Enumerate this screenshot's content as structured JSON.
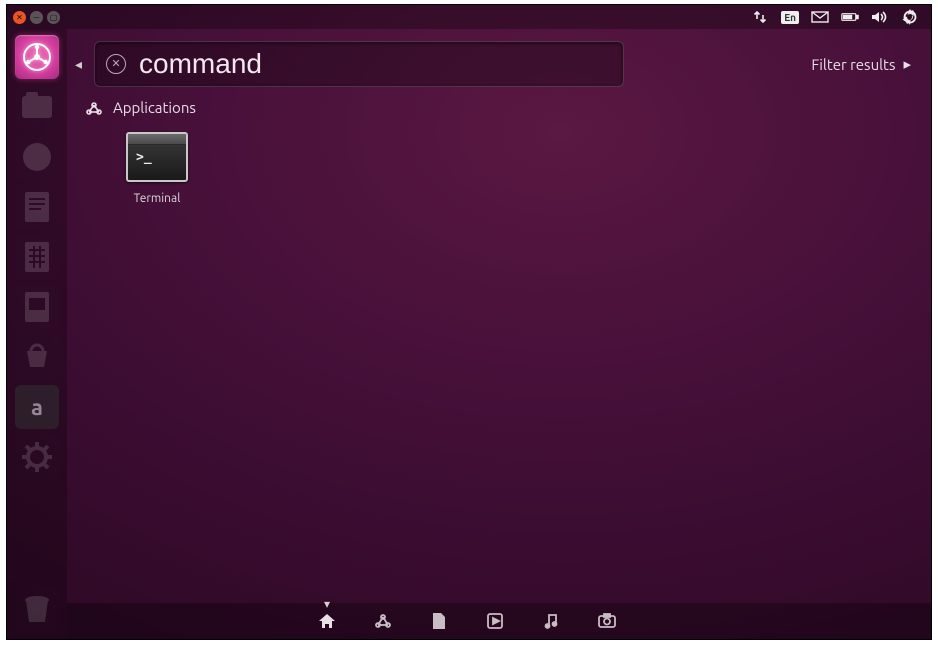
{
  "topbar": {
    "language_indicator": "En"
  },
  "launcher": {
    "amazon_label": "a"
  },
  "dash": {
    "search_value": "command",
    "filter_label": "Filter results",
    "section_label": "Applications",
    "results": [
      {
        "label": "Terminal",
        "prompt": ">_"
      }
    ]
  },
  "lenses": [
    "home",
    "applications",
    "files",
    "video",
    "music",
    "photos"
  ]
}
